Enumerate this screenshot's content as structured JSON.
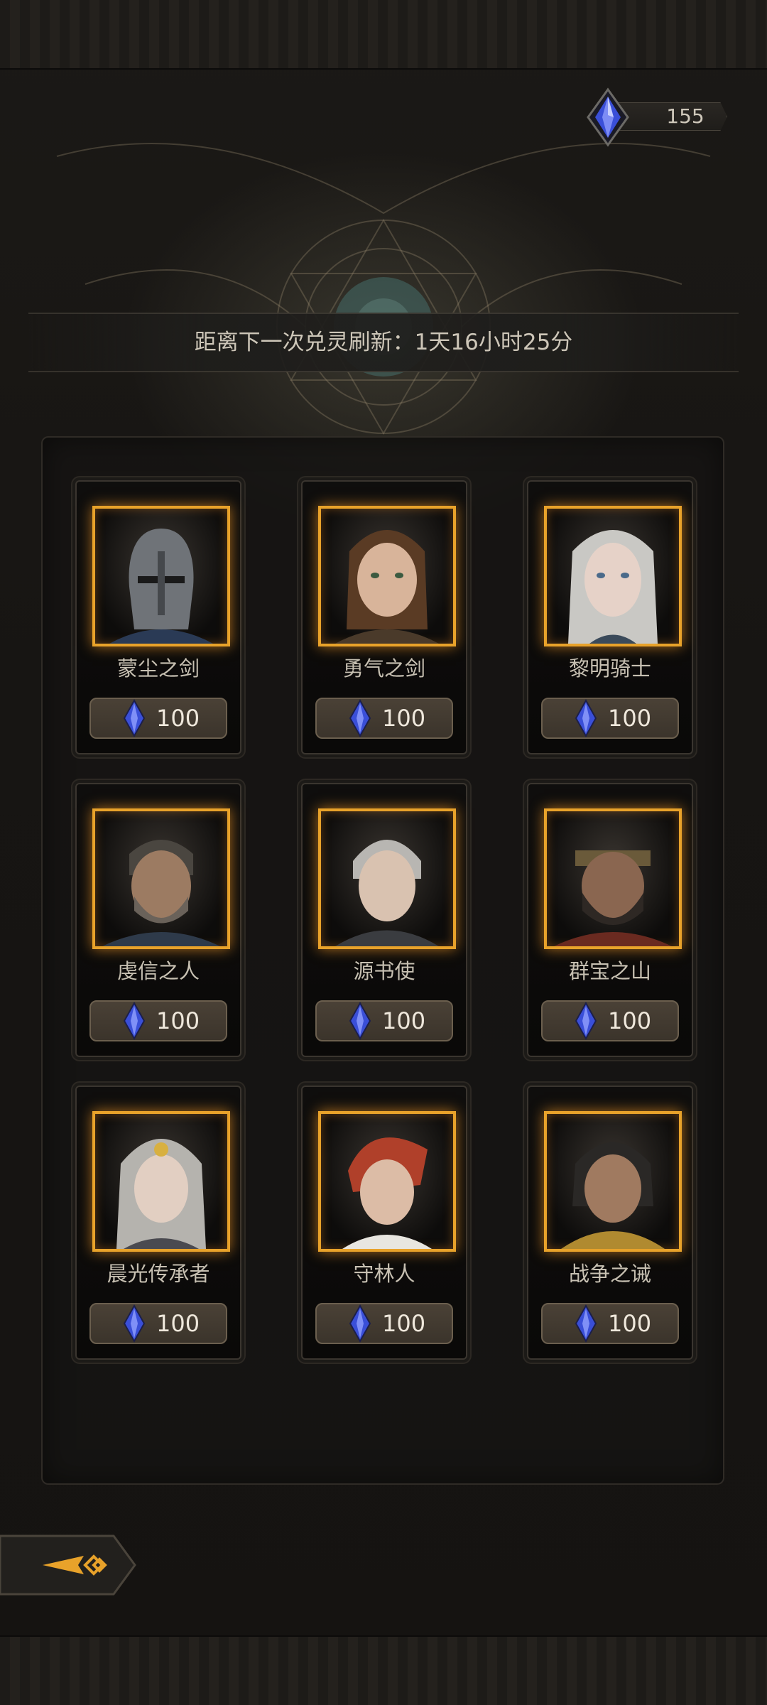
{
  "currency": {
    "icon": "crystal-gem-icon",
    "amount": "155"
  },
  "refresh": {
    "text": "距离下一次兑灵刷新：1天16小时25分"
  },
  "heroes": [
    {
      "name": "蒙尘之剑",
      "cost": "100",
      "portrait": "helmeted-knight-portrait"
    },
    {
      "name": "勇气之剑",
      "cost": "100",
      "portrait": "brunette-heroine-portrait"
    },
    {
      "name": "黎明骑士",
      "cost": "100",
      "portrait": "silver-haired-knight-portrait"
    },
    {
      "name": "虔信之人",
      "cost": "100",
      "portrait": "bearded-warrior-portrait"
    },
    {
      "name": "源书使",
      "cost": "100",
      "portrait": "silver-haired-youth-portrait"
    },
    {
      "name": "群宝之山",
      "cost": "100",
      "portrait": "bearded-merchant-portrait"
    },
    {
      "name": "晨光传承者",
      "cost": "100",
      "portrait": "armored-heroine-portrait"
    },
    {
      "name": "守林人",
      "cost": "100",
      "portrait": "red-haired-ranger-portrait"
    },
    {
      "name": "战争之诫",
      "cost": "100",
      "portrait": "dark-haired-warrior-portrait"
    }
  ],
  "colors": {
    "frame_gold": "#e8a22a",
    "gem_blue": "#3a4fd8",
    "button_bg": "#453c32",
    "text_light": "#c7c0b2"
  },
  "back_button": {
    "icon": "back-arrow-icon"
  }
}
